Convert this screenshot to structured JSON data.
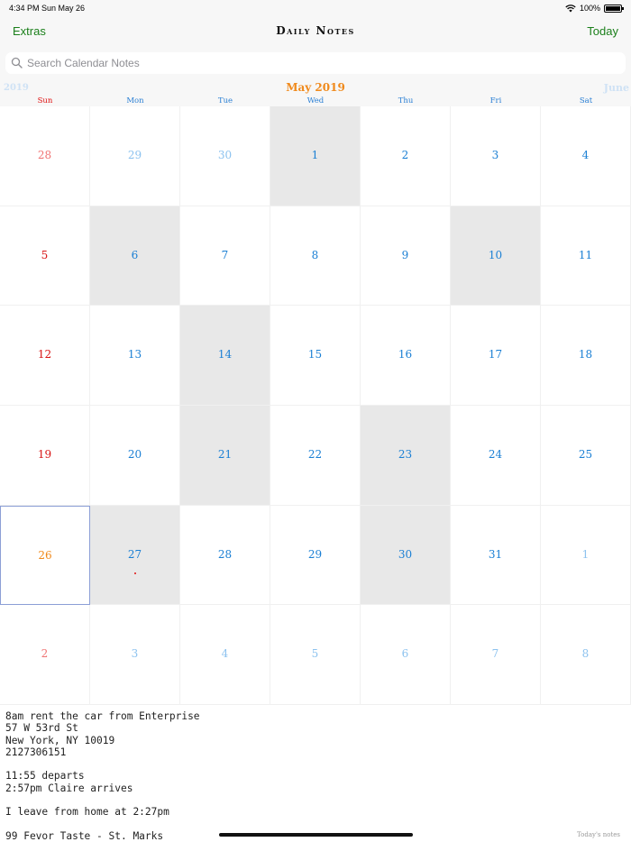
{
  "status": {
    "time_date": "4:34 PM   Sun May 26",
    "battery": "100%",
    "battery_level": 1.0,
    "wifi_icon": "wifi-icon",
    "battery_icon": "battery-icon"
  },
  "nav": {
    "extras": "Extras",
    "title": "Daily Notes",
    "today": "Today"
  },
  "search": {
    "placeholder": "Search Calendar Notes",
    "value": "",
    "icon": "search-icon"
  },
  "calendar": {
    "prev_label": "2019",
    "month_title": "May 2019",
    "next_label": "June",
    "weekdays": [
      "Sun",
      "Mon",
      "Tue",
      "Wed",
      "Thu",
      "Fri",
      "Sat"
    ],
    "weeks": [
      [
        {
          "day": "28",
          "type": "outsun"
        },
        {
          "day": "29",
          "type": "out"
        },
        {
          "day": "30",
          "type": "out"
        },
        {
          "day": "1",
          "type": "cur",
          "shaded": true
        },
        {
          "day": "2",
          "type": "cur"
        },
        {
          "day": "3",
          "type": "cur"
        },
        {
          "day": "4",
          "type": "cur"
        }
      ],
      [
        {
          "day": "5",
          "type": "sun"
        },
        {
          "day": "6",
          "type": "cur",
          "shaded": true
        },
        {
          "day": "7",
          "type": "cur"
        },
        {
          "day": "8",
          "type": "cur"
        },
        {
          "day": "9",
          "type": "cur"
        },
        {
          "day": "10",
          "type": "cur",
          "shaded": true
        },
        {
          "day": "11",
          "type": "cur"
        }
      ],
      [
        {
          "day": "12",
          "type": "sun"
        },
        {
          "day": "13",
          "type": "cur"
        },
        {
          "day": "14",
          "type": "cur",
          "shaded": true
        },
        {
          "day": "15",
          "type": "cur"
        },
        {
          "day": "16",
          "type": "cur"
        },
        {
          "day": "17",
          "type": "cur"
        },
        {
          "day": "18",
          "type": "cur"
        }
      ],
      [
        {
          "day": "19",
          "type": "sun"
        },
        {
          "day": "20",
          "type": "cur"
        },
        {
          "day": "21",
          "type": "cur",
          "shaded": true
        },
        {
          "day": "22",
          "type": "cur"
        },
        {
          "day": "23",
          "type": "cur",
          "shaded": true
        },
        {
          "day": "24",
          "type": "cur"
        },
        {
          "day": "25",
          "type": "cur"
        }
      ],
      [
        {
          "day": "26",
          "type": "today",
          "selected": true
        },
        {
          "day": "27",
          "type": "cur",
          "shaded": true,
          "has_note": true
        },
        {
          "day": "28",
          "type": "cur"
        },
        {
          "day": "29",
          "type": "cur"
        },
        {
          "day": "30",
          "type": "cur",
          "shaded": true
        },
        {
          "day": "31",
          "type": "cur"
        },
        {
          "day": "1",
          "type": "out"
        }
      ],
      [
        {
          "day": "2",
          "type": "outsun"
        },
        {
          "day": "3",
          "type": "out"
        },
        {
          "day": "4",
          "type": "out"
        },
        {
          "day": "5",
          "type": "out"
        },
        {
          "day": "6",
          "type": "out"
        },
        {
          "day": "7",
          "type": "out"
        },
        {
          "day": "8",
          "type": "out"
        }
      ]
    ]
  },
  "notes": {
    "text": "8am rent the car from Enterprise\n57 W 53rd St\nNew York, NY 10019\n2127306151\n\n11:55 departs\n2:57pm Claire arrives\n\nI leave from home at 2:27pm\n\n99 Fevor Taste - St. Marks",
    "label": "Today's notes"
  },
  "colors": {
    "nav_accent": "#1a7f1a",
    "month_title": "#f08a1c",
    "weekday": "#1a7fd4",
    "sunday": "#d81414",
    "out_of_month": "#8cc2ef",
    "shaded_day": "#e8e8e8"
  }
}
